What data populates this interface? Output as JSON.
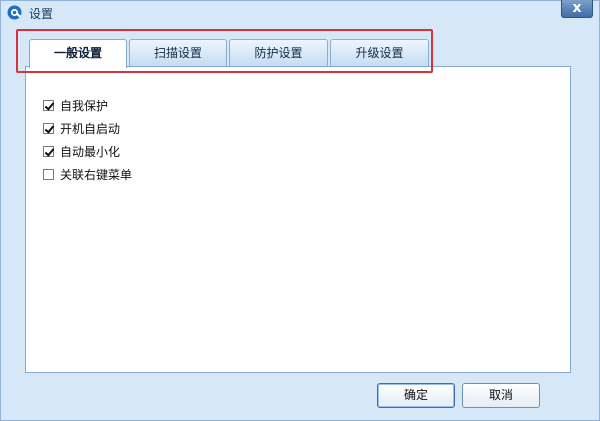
{
  "window": {
    "title": "设置",
    "close_glyph": "x"
  },
  "tabs": [
    {
      "label": "一般设置",
      "active": true
    },
    {
      "label": "扫描设置",
      "active": false
    },
    {
      "label": "防护设置",
      "active": false
    },
    {
      "label": "升级设置",
      "active": false
    }
  ],
  "options": [
    {
      "label": "自我保护",
      "checked": true
    },
    {
      "label": "开机自启动",
      "checked": true
    },
    {
      "label": "自动最小化",
      "checked": true
    },
    {
      "label": "关联右键菜单",
      "checked": false
    }
  ],
  "buttons": {
    "ok": "确定",
    "cancel": "取消"
  },
  "colors": {
    "window_bg": "#d6e8f8",
    "highlight_outline": "#d9323a",
    "app_icon": "#1e6fc2"
  }
}
